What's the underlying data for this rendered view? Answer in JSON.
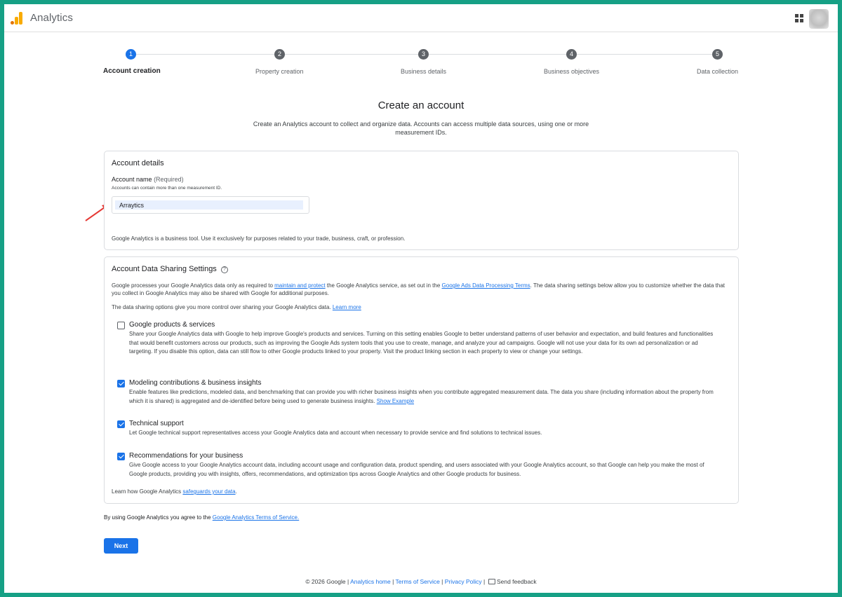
{
  "header": {
    "app_title": "Analytics",
    "apps_icon": "apps-grid-icon",
    "avatar": "account-avatar"
  },
  "stepper": {
    "steps": [
      {
        "number": "1",
        "label": "Account creation",
        "active": true
      },
      {
        "number": "2",
        "label": "Property creation",
        "active": false
      },
      {
        "number": "3",
        "label": "Business details",
        "active": false
      },
      {
        "number": "4",
        "label": "Business objectives",
        "active": false
      },
      {
        "number": "5",
        "label": "Data collection",
        "active": false
      }
    ]
  },
  "page": {
    "title": "Create an account",
    "subtitle": "Create an Analytics account to collect and organize data. Accounts can access multiple data sources, using one or more measurement IDs."
  },
  "account_details": {
    "title": "Account details",
    "field_label": "Account name",
    "required": "(Required)",
    "hint": "Accounts can contain more than one measurement ID.",
    "account_name_value": "Arraytics",
    "business_note": "Google Analytics is a business tool. Use it exclusively for purposes related to your trade, business, craft, or profession."
  },
  "sharing": {
    "title": "Account Data Sharing Settings",
    "intro_1_a": "Google processes your Google Analytics data only as required to ",
    "intro_1_link1": "maintain and protect",
    "intro_1_b": " the Google Analytics service, as set out in the ",
    "intro_1_link2": "Google Ads Data Processing Terms",
    "intro_1_c": ". The data sharing settings below allow you to customize whether the data that you collect in Google Analytics may also be shared with Google for additional purposes.",
    "intro_2": "The data sharing options give you more control over sharing your Google Analytics data.",
    "intro_2_link": "Learn more",
    "options": [
      {
        "title": "Google products & services",
        "checked": false,
        "desc": "Share your Google Analytics data with Google to help improve Google's products and services. Turning on this setting enables Google to better understand patterns of user behavior and expectation, and build features and functionalities that would benefit customers across our products, such as improving the Google Ads system tools that you use to create, manage, and analyze your ad campaigns. Google will not use your data for its own ad personalization or ad targeting. If you disable this option, data can still flow to other Google products linked to your property. Visit the product linking section in each property to view or change your settings."
      },
      {
        "title": "Modeling contributions & business insights",
        "checked": true,
        "desc": "Enable features like predictions, modeled data, and benchmarking that can provide you with richer business insights when you contribute aggregated measurement data. The data you share (including information about the property from which it is shared) is aggregated and de-identified before being used to generate business insights.",
        "link": "Show Example"
      },
      {
        "title": "Technical support",
        "checked": true,
        "desc": "Let Google technical support representatives access your Google Analytics data and account when necessary to provide service and find solutions to technical issues."
      },
      {
        "title": "Recommendations for your business",
        "checked": true,
        "desc": "Give Google access to your Google Analytics account data, including account usage and configuration data, product spending, and users associated with your Google Analytics account, so that Google can help you make the most of Google products, providing you with insights, offers, recommendations, and optimization tips across Google Analytics and other Google products for business."
      }
    ],
    "safeguards_text": "Learn how Google Analytics ",
    "safeguards_link": "safeguards your data",
    "safeguards_end": "."
  },
  "tos": {
    "text": "By using Google Analytics you agree to the ",
    "link": "Google Analytics Terms of Service."
  },
  "next_label": "Next",
  "footer": {
    "copyright": "© 2026 Google",
    "analytics_home": "Analytics home",
    "terms": "Terms of Service",
    "privacy": "Privacy Policy",
    "feedback": "Send feedback"
  },
  "colors": {
    "accent": "#1a73e8",
    "frame": "#16a085",
    "annotation_arrow": "#e53935"
  }
}
